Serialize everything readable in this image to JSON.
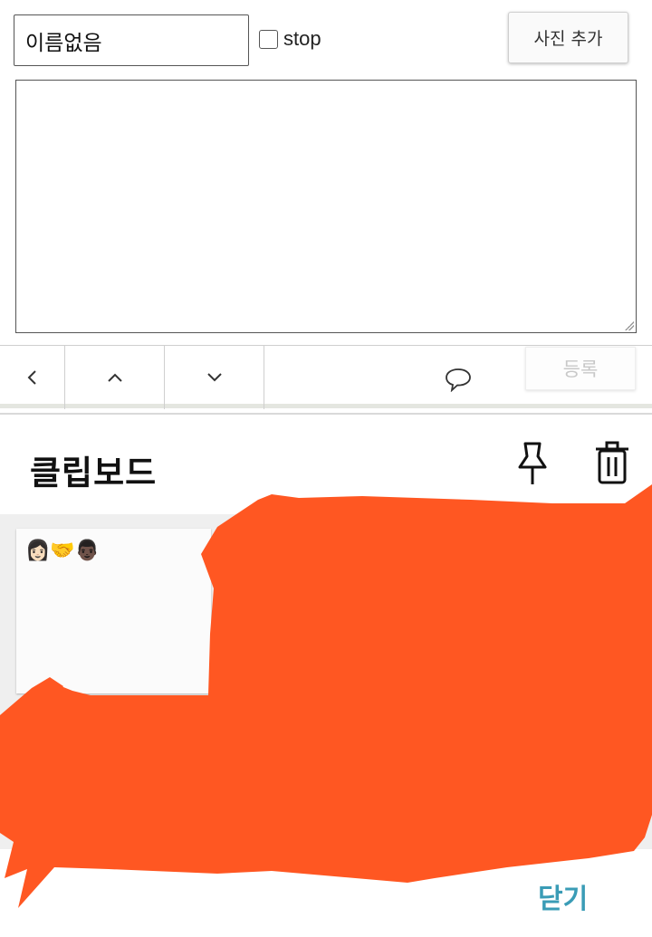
{
  "composer": {
    "name_value": "이름없음",
    "stop_label": "stop",
    "stop_checked": false,
    "photo_button_label": "사진 추가",
    "message_value": ""
  },
  "nav": {
    "prev_icon": "chevron-left-icon",
    "up_icon": "chevron-up-icon",
    "down_icon": "chevron-down-icon",
    "chat_icon": "speech-bubble-icon",
    "register_label": "등록"
  },
  "clipboard": {
    "title": "클립보드",
    "pin_icon": "pin-icon",
    "trash_icon": "trash-icon",
    "items": [
      {
        "text": "👩🏻🤝👨🏿"
      }
    ],
    "close_label": "닫기"
  },
  "colors": {
    "redaction": "#ff5722",
    "close_accent": "#3a9cb6"
  }
}
